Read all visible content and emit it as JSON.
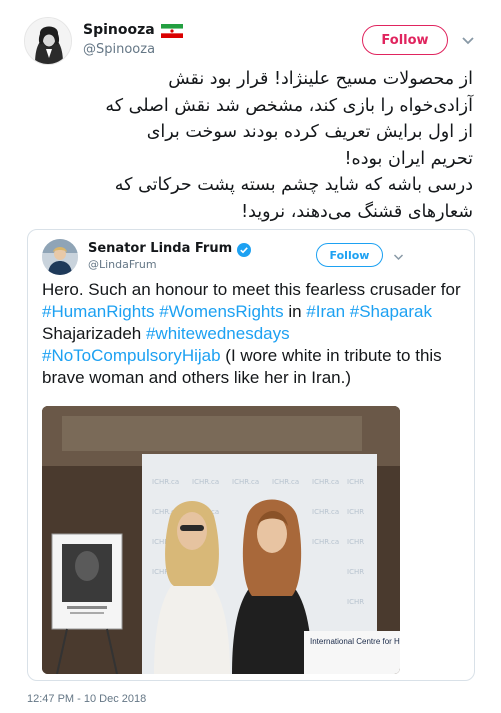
{
  "author": {
    "display_name": "Spinooza",
    "handle": "@Spinooza",
    "follow_label": "Follow",
    "follow_color": "#e0245e"
  },
  "tweet": {
    "lines": [
      "از محصولات مسیح علینژاد! قرار بود نقش",
      "آزادی‌خواه را بازی کند، مشخص شد نقش اصلی که",
      "از اول برایش تعریف کرده بودند سوخت برای",
      "تحریم ایران بوده!",
      "درسی باشه که شاید چشم بسته پشت حرکاتی که",
      "شعارهای قشنگ می‌دهند، نروید!"
    ]
  },
  "quoted": {
    "display_name": "Senator Linda Frum",
    "handle": "@LindaFrum",
    "follow_label": "Follow",
    "text_parts": {
      "p1": "Hero. Such an honour to meet this fearless crusader for ",
      "t1": "#HumanRights",
      "s1": " ",
      "t2": "#WomensRights",
      "p2": " in ",
      "t3": "#Iran",
      "s2": " ",
      "t4": "#Shaparak",
      "p3": " Shajarizadeh ",
      "t5": "#whitewednesdays",
      "s3": " ",
      "t6": "#NoToCompulsoryHijab",
      "p4": " (I wore white in tribute to this brave woman and others like her in Iran.)"
    },
    "photo_sign": "International Centre for Human Rights",
    "accent": "#1da1f2"
  },
  "timestamp": "12:47 PM - 10 Dec 2018",
  "icons": [
    "chevron-down-icon",
    "flag-iran-icon",
    "verified-badge-icon"
  ]
}
